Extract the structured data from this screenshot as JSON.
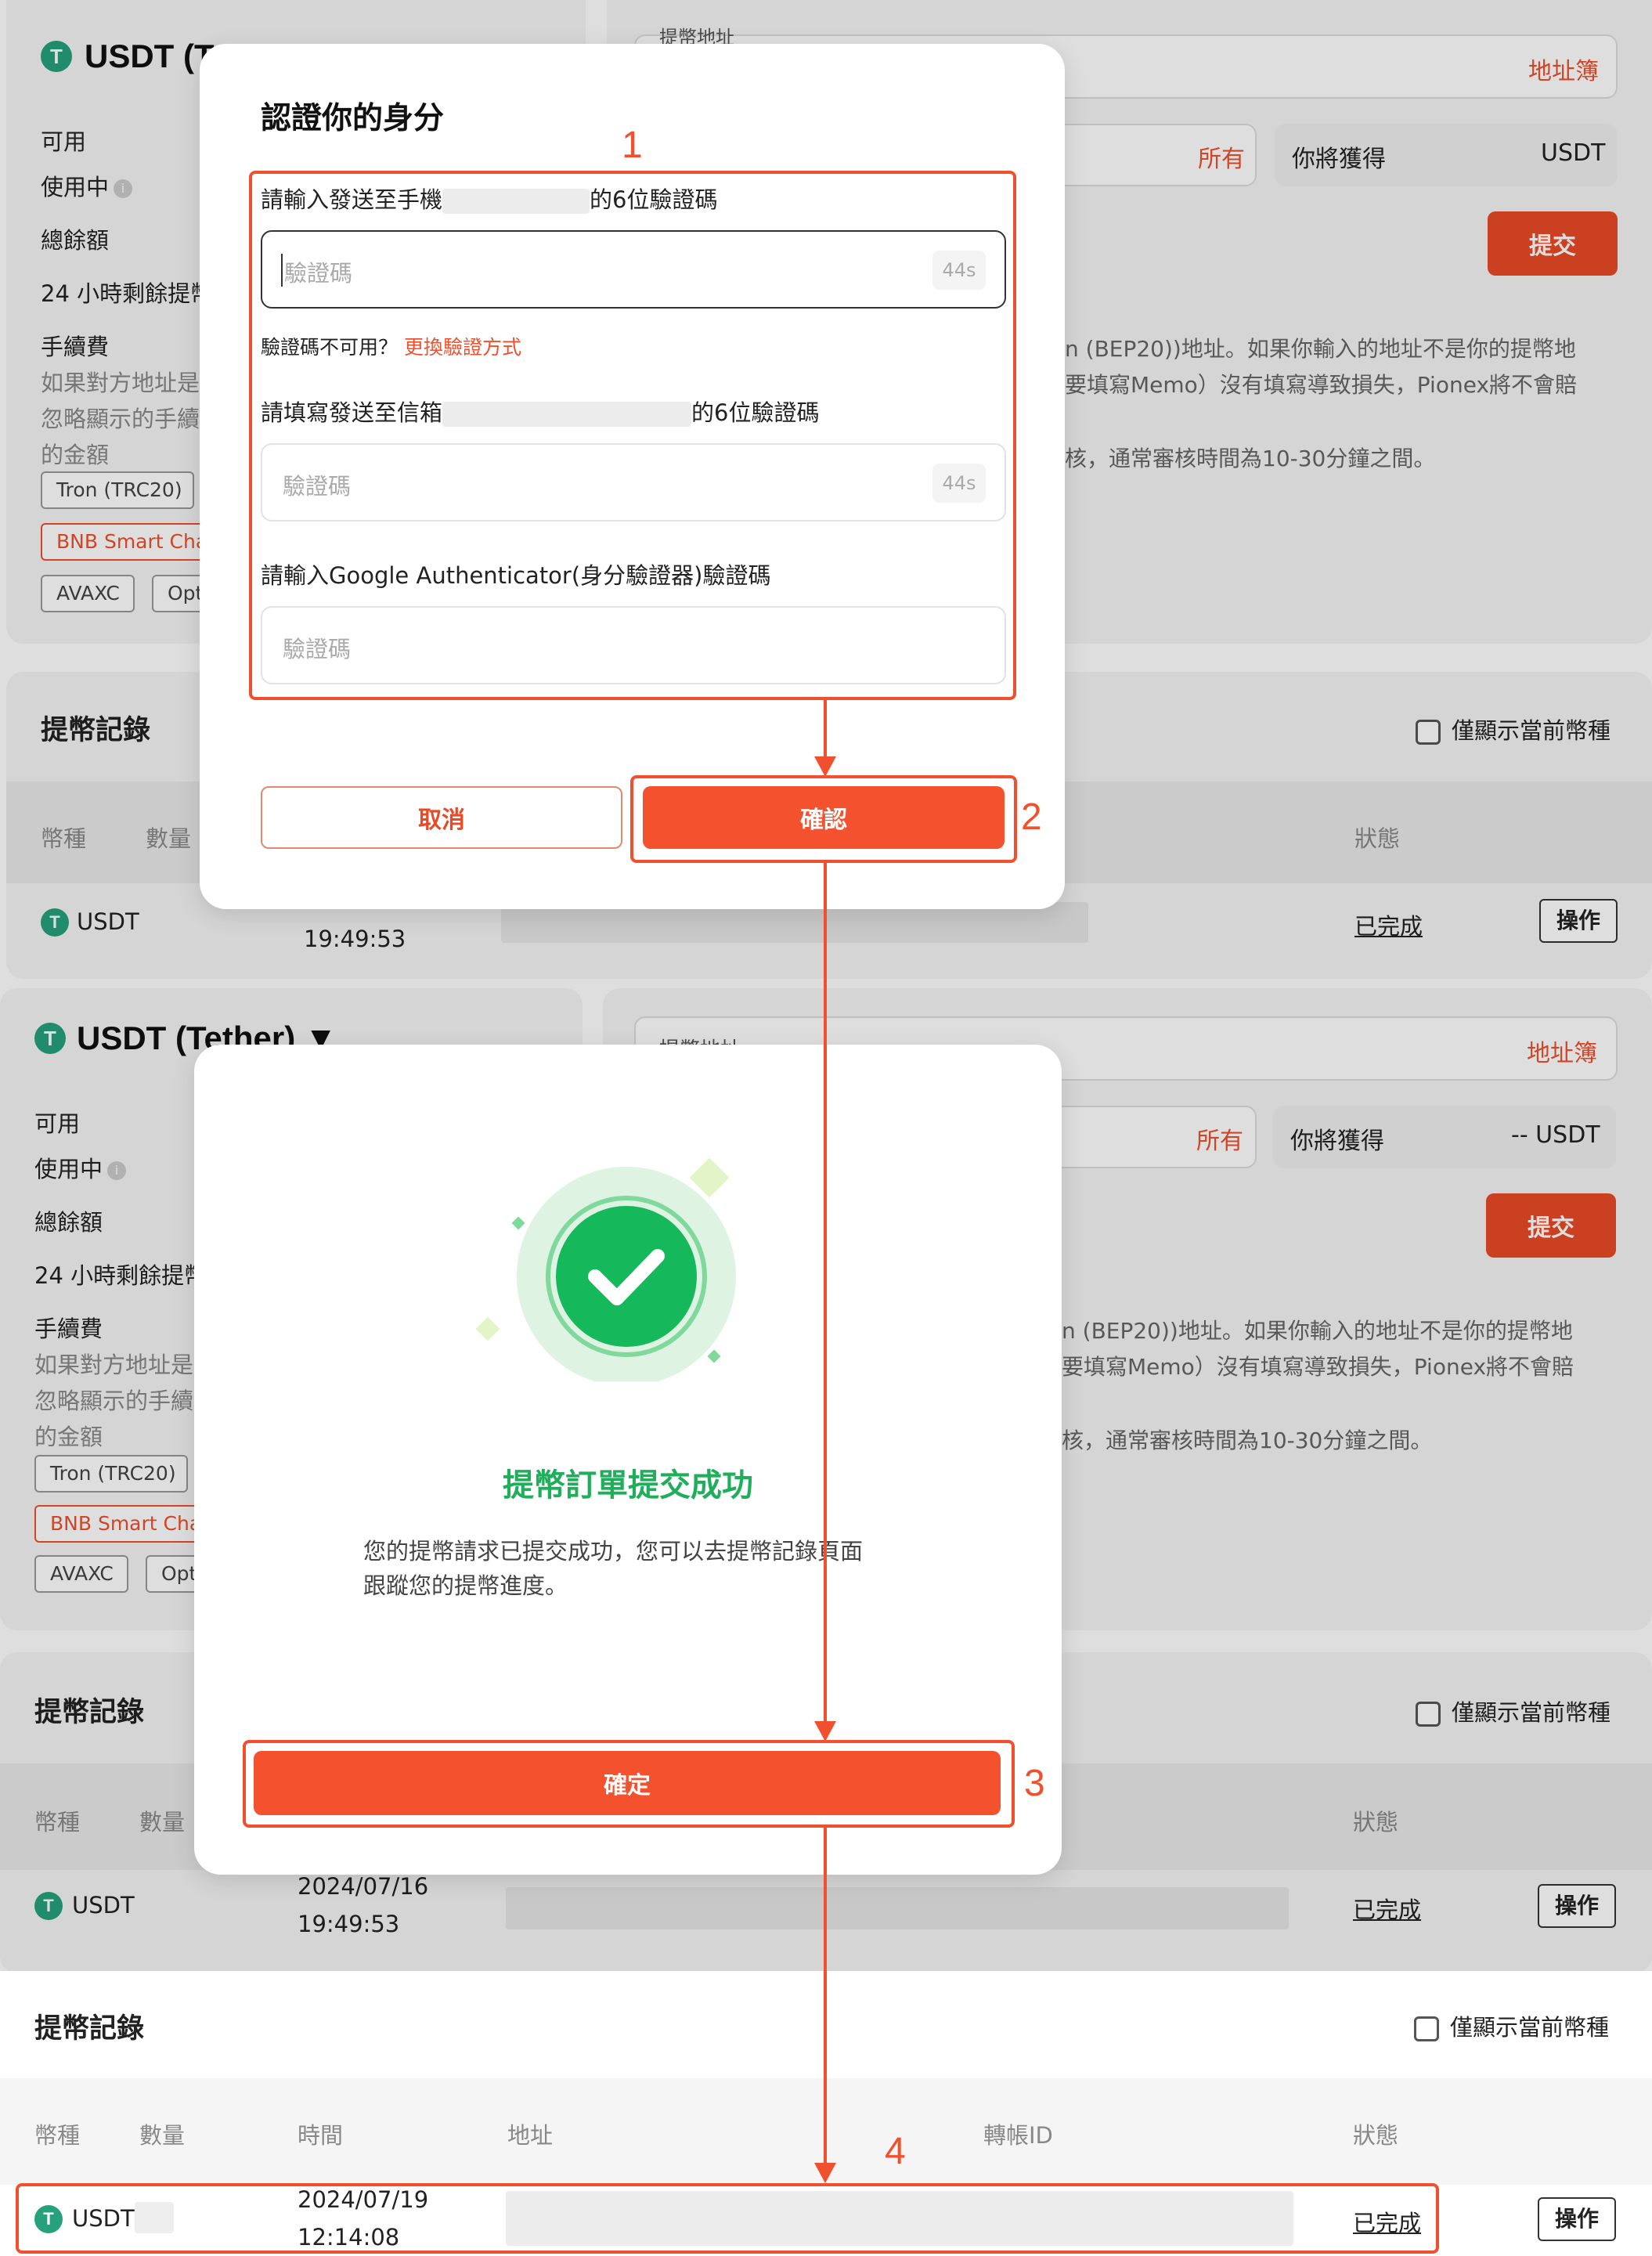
{
  "top_panel": {
    "coin_title": "USDT (Te",
    "available": "可用",
    "in_use": "使用中",
    "total_balance": "總餘額",
    "remaining_24h": "24 小時剩餘提幣",
    "fee": "手續費",
    "fee_desc_1": "如果對方地址是",
    "fee_desc_2": "忽略顯示的手續",
    "fee_desc_3": "的金額",
    "chips": [
      "Tron (TRC20)",
      "BNB Smart Cha",
      "AVAXC",
      "Opt"
    ],
    "address_label": "提幣地址",
    "address_book": "地址簿",
    "all": "所有",
    "you_get": "你將獲得",
    "you_get_value": "USDT",
    "submit": "提交",
    "notice_1": "n (BEP20))地址。如果你輸入的地址不是你的提幣地",
    "notice_2": "要填寫Memo）沒有填寫導致損失，Pionex將不會賠",
    "notice_3": "核，通常審核時間為10-30分鐘之間。"
  },
  "top_records": {
    "title": "提幣記錄",
    "only_current": "僅顯示當前幣種",
    "col_coin": "幣種",
    "col_amount": "數量",
    "col_status": "狀態",
    "row_coin": "USDT",
    "row_time": "19:49:53",
    "row_status": "已完成",
    "op": "操作"
  },
  "verify_modal": {
    "title": "認證你的身分",
    "phone_label_pre": "請輸入發送至手機",
    "phone_label_post": "的6位驗證碼",
    "placeholder": "驗證碼",
    "timer": "44s",
    "unavailable": "驗證碼不可用？",
    "change_method": "更換驗證方式",
    "email_label_pre": "請填寫發送至信箱",
    "email_label_post": "的6位驗證碼",
    "google_label": "請輸入Google Authenticator(身分驗證器)驗證碼",
    "cancel": "取消",
    "confirm": "確認"
  },
  "mid_panel": {
    "coin_title": "USDT (Tether) ▼",
    "address_label": "提幣地址",
    "you_get_value": "-- USDT"
  },
  "mid_records": {
    "row_date": "2024/07/16",
    "row_time": "19:49:53"
  },
  "success_modal": {
    "title": "提幣訂單提交成功",
    "desc_1": "您的提幣請求已提交成功，您可以去提幣記錄頁面",
    "desc_2": "跟蹤您的提幣進度。",
    "ok": "確定"
  },
  "bottom_records": {
    "title": "提幣記錄",
    "only_current": "僅顯示當前幣種",
    "col_coin": "幣種",
    "col_amount": "數量",
    "col_time": "時間",
    "col_address": "地址",
    "col_txid": "轉帳ID",
    "col_status": "狀態",
    "row_coin": "USDT",
    "row_date": "2024/07/19",
    "row_time": "12:14:08",
    "row_status": "已完成",
    "op": "操作"
  },
  "annotations": [
    "1",
    "2",
    "3",
    "4"
  ],
  "colors": {
    "accent": "#f0502d",
    "success": "#1fbf5f",
    "tether": "#26a17b"
  }
}
